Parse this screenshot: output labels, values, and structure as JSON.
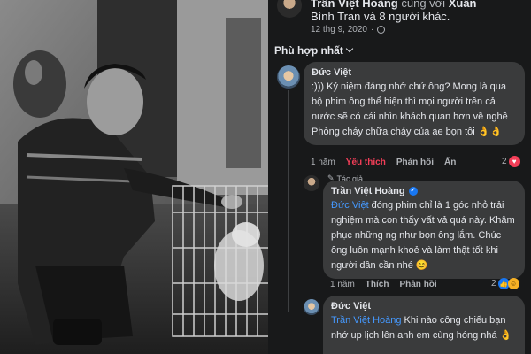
{
  "post": {
    "author": "Trần Việt Hoàng",
    "with_text": "cùng với",
    "tagged": "Xuân",
    "line2": "Bình Tran và 8 người khác.",
    "date": "12 thg 9, 2020",
    "date_sep": "·"
  },
  "sort": {
    "label": "Phù hợp nhất"
  },
  "comment1": {
    "name": "Đức Việt",
    "text": ":))) Kỷ niệm đáng nhớ chứ ông? Mong là qua bộ phim ông thể hiện thì mọi người trên cả nước sẽ có cái nhìn khách quan hơn về nghề Phòng cháy chữa cháy của ae bọn tôi 👌👌",
    "time": "1 năm",
    "like": "Yêu thích",
    "reply": "Phản hồi",
    "hide": "Ẩn",
    "reaction_count": "2"
  },
  "reply1": {
    "author_badge": "Tác giả",
    "name": "Trần Việt Hoàng",
    "mention": "Đức Việt",
    "text": " đóng phim chỉ là 1 góc nhỏ trải nghiệm mà con thấy vất vả quá này. Khâm phục những ng như bọn ông lắm. Chúc ông luôn mạnh khoẻ và làm thật tốt khi người dân cần nhé 😊",
    "time": "1 năm",
    "like": "Thích",
    "reply": "Phản hồi",
    "reaction_count": "2"
  },
  "reply2": {
    "name": "Đức Việt",
    "mention": "Trần Việt Hoàng",
    "text": " Khi nào công chiếu bạn nhớ up lịch lên anh em cùng hóng nhá 👌"
  },
  "icons": {
    "globe": "globe-icon",
    "chevron": "chevron-down-icon",
    "verified": "verified-badge-icon",
    "heart": "heart-reaction-icon",
    "like": "like-reaction-icon",
    "haha": "haha-reaction-icon",
    "emoji_face": "smiling-face-icon"
  },
  "colors": {
    "background": "#18191a",
    "bubble": "#3a3b3c",
    "mention": "#4599ff",
    "liked": "#f33e58",
    "verified": "#1877f2"
  }
}
